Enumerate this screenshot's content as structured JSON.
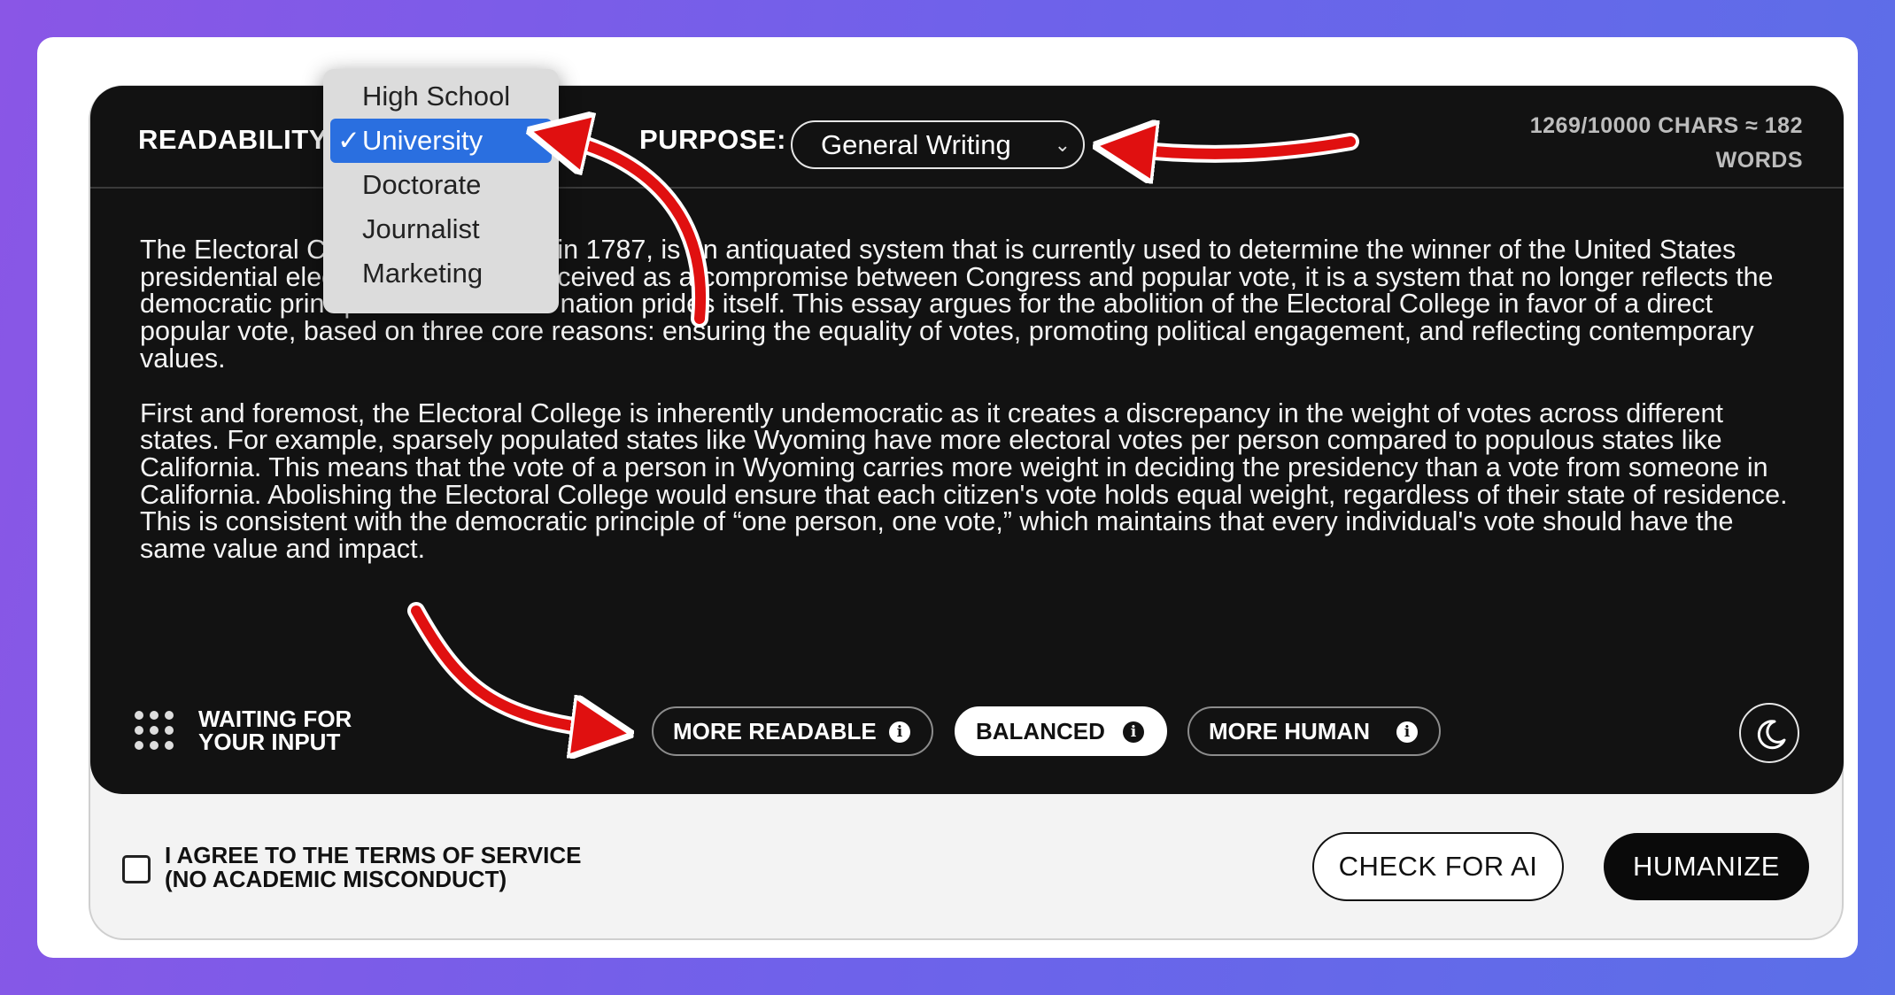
{
  "toolbar": {
    "readability_label": "READABILITY:",
    "purpose_label": "PURPOSE:",
    "purpose_value": "General Writing",
    "counter_line1": "1269/10000 CHARS ≈ 182",
    "counter_line2": "WORDS"
  },
  "readability_dropdown": {
    "options": [
      "High School",
      "University",
      "Doctorate",
      "Journalist",
      "Marketing"
    ],
    "selected": "University",
    "check_glyph": "✓"
  },
  "essay": {
    "paragraphs": [
      "The Electoral College, established in 1787, is an antiquated system that is currently used to determine the winner of the United States presidential election. Originally conceived as a compromise between Congress and popular vote, it is a system that no longer reflects the democratic principles on which the nation prides itself. This essay argues for the abolition of the Electoral College in favor of a direct popular vote, based on three core reasons: ensuring the equality of votes, promoting political engagement, and reflecting contemporary values.",
      "First and foremost, the Electoral College is inherently undemocratic as it creates a discrepancy in the weight of votes across different states. For example, sparsely populated states like Wyoming have more electoral votes per person compared to populous states like California. This means that the vote of a person in Wyoming carries more weight in deciding the presidency than a vote from someone in California. Abolishing the Electoral College would ensure that each citizen's vote holds equal weight, regardless of their state of residence. This is consistent with the democratic principle of “one person, one vote,” which maintains that every individual's vote should have the same value and impact."
    ]
  },
  "status": {
    "line1": "WAITING FOR",
    "line2": "YOUR INPUT"
  },
  "modes": [
    {
      "label": "MORE READABLE",
      "active": false
    },
    {
      "label": "BALANCED",
      "active": true
    },
    {
      "label": "MORE HUMAN",
      "active": false
    }
  ],
  "info_glyph": "i",
  "footer": {
    "terms_line1": "I AGREE TO THE TERMS OF SERVICE",
    "terms_line2": "(NO ACADEMIC MISCONDUCT)",
    "check_button": "CHECK FOR AI",
    "humanize_button": "HUMANIZE"
  },
  "icons": {
    "status_icon": "dots-grid-icon",
    "theme_toggle": "moon-icon",
    "info": "info-icon",
    "select_chevron": "chevron-down-icon"
  },
  "colors": {
    "editor_bg": "#121212",
    "annotation_arrow": "#e01010",
    "selected_option": "#2a6fe0"
  }
}
